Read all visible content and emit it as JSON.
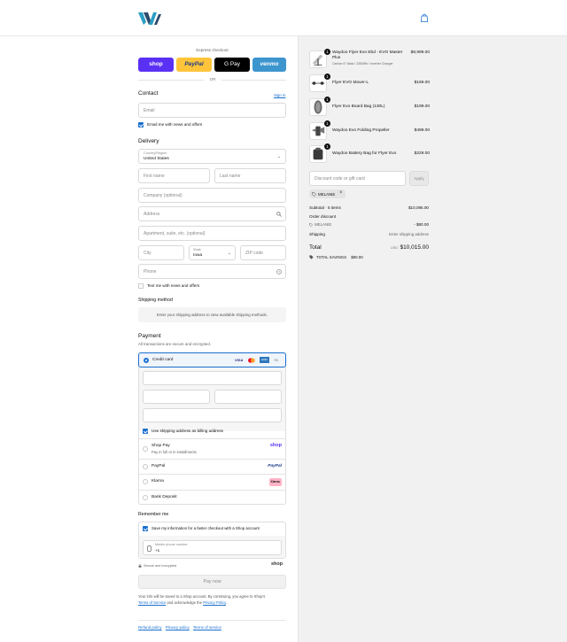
{
  "checkout": {
    "express_label": "Express checkout",
    "or_label": "OR",
    "wallets": [
      {
        "label": "shop",
        "color": "#5a31f4"
      },
      {
        "label": "PayPal",
        "color": "#ffc439"
      },
      {
        "label": "G Pay",
        "color": "#000000"
      },
      {
        "label": "venmo",
        "color": "#3d95ce"
      }
    ],
    "contact": {
      "heading": "Contact",
      "sign_in": "Sign in",
      "email_placeholder": "Email",
      "newsletter_label": "Email me with news and offers"
    },
    "delivery": {
      "heading": "Delivery",
      "country_label": "Country/Region",
      "country_value": "United States",
      "first_name": "First name",
      "last_name": "Last name",
      "company": "Company (optional)",
      "address": "Address",
      "apartment": "Apartment, suite, etc. (optional)",
      "city": "City",
      "state_label": "State",
      "state_value": "Iowa",
      "zip": "ZIP code",
      "phone": "Phone",
      "text_label": "Text me with news and offers"
    },
    "shipping": {
      "heading": "Shipping method",
      "notice": "Enter your shipping address to view available shipping methods."
    },
    "payment": {
      "heading": "Payment",
      "subtitle": "All transactions are secure and encrypted.",
      "credit_card": "Credit card",
      "card_more": "+5",
      "billing_label": "Use shipping address as billing address",
      "options": [
        {
          "label": "Shop Pay",
          "sub": "Pay in full or in installments",
          "logo": "shop"
        },
        {
          "label": "PayPal",
          "sub": "",
          "logo": "PayPal"
        },
        {
          "label": "Klarna",
          "sub": "",
          "logo": "Klarna."
        },
        {
          "label": "Bank Deposit",
          "sub": "",
          "logo": ""
        }
      ]
    },
    "remember": {
      "heading": "Remember me",
      "save_label": "Save my information for a faster checkout with a Shop account",
      "mobile_label": "Mobile phone number",
      "mobile_value": "+1",
      "secure_label": "Secure and encrypted",
      "shop_logo": "shop"
    },
    "pay_button": "Pay now",
    "legal_1": "Your info will be saved to a Shop account. By continuing, you agree to Shop's",
    "legal_terms": "Terms of Service",
    "legal_mid": "and acknowledge the",
    "legal_privacy": "Privacy Policy",
    "legal_end": ".",
    "footer_links": [
      "Refund policy",
      "Privacy policy",
      "Terms of service"
    ]
  },
  "summary": {
    "items": [
      {
        "qty": "1",
        "name": "Waydoo Flyer Evo Ebd - EVO Master Plus",
        "variant": "Carbon 6\" Mast / 2350Wh / Inverter Charger",
        "price": "$8,999.00"
      },
      {
        "qty": "1",
        "name": "Flyer EVO Mover-L",
        "variant": "",
        "price": "$169.00"
      },
      {
        "qty": "1",
        "name": "Flyer Evo Board Bag (130L)",
        "variant": "",
        "price": "$199.00"
      },
      {
        "qty": "1",
        "name": "Waydoo Evo Folding Propeller",
        "variant": "",
        "price": "$499.00"
      },
      {
        "qty": "1",
        "name": "Waydoo Battery Bag for Flyer Evo",
        "variant": "",
        "price": "$229.00"
      }
    ],
    "discount_placeholder": "Discount code or gift card",
    "apply_label": "Apply",
    "code_tag": "MELANIE",
    "subtotal_label": "Subtotal · 5 items",
    "subtotal_value": "$10,095.00",
    "order_discount_label": "Order discount",
    "discount_code": "MELANIE",
    "discount_value": "- $80.00",
    "shipping_label": "Shipping",
    "shipping_value": "Enter shipping address",
    "total_label": "Total",
    "currency": "USD",
    "total_value": "$10,015.00",
    "savings_label": "TOTAL SAVINGS",
    "savings_value": "$80.00"
  }
}
